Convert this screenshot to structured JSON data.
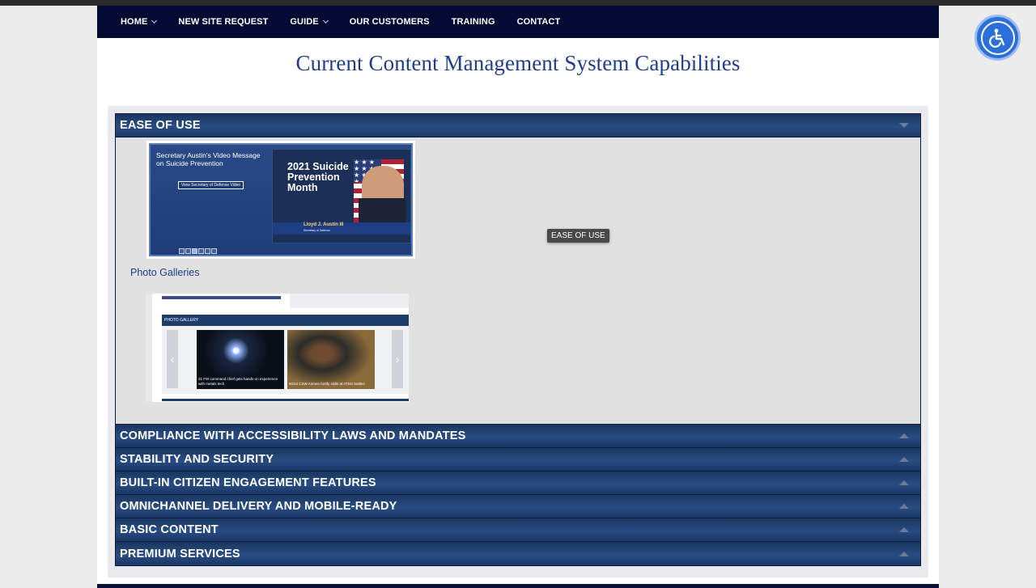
{
  "nav": {
    "items": [
      {
        "label": "HOME",
        "has_caret": true
      },
      {
        "label": "NEW SITE REQUEST",
        "has_caret": false
      },
      {
        "label": "GUIDE",
        "has_caret": true
      },
      {
        "label": "OUR CUSTOMERS",
        "has_caret": false
      },
      {
        "label": "TRAINING",
        "has_caret": false
      },
      {
        "label": "CONTACT",
        "has_caret": false
      }
    ]
  },
  "page_title": "Current Content Management System Capabilities",
  "accordion": {
    "open_section": {
      "label": "EASE OF USE",
      "tooltip": "EASE OF USE",
      "slideshow": {
        "message_title": "Secretary Austin's Video Message on Suicide Prevention",
        "video_button": "View Secretary of Defense Video",
        "poster_text": "2021 Suicide Prevention Month",
        "poster_name": "Lloyd J. Austin III",
        "poster_role": "Secretary of Defense",
        "slide_count": 6,
        "active_slide": 3
      },
      "gallery_link": "Photo Galleries",
      "gallery": {
        "header": "PHOTO GALLERY",
        "captions": [
          "31 FW command chief gets hands-on experience with metals tech",
          "501st CSW Airmen fortify skills at ATSO battles"
        ]
      }
    },
    "sections": [
      {
        "label": "COMPLIANCE WITH ACCESSIBILITY LAWS AND MANDATES"
      },
      {
        "label": "STABILITY AND SECURITY"
      },
      {
        "label": "BUILT-IN CITIZEN ENGAGEMENT FEATURES"
      },
      {
        "label": "OMNICHANNEL DELIVERY AND MOBILE-READY"
      },
      {
        "label": "BASIC CONTENT"
      },
      {
        "label": "PREMIUM SERVICES"
      }
    ]
  },
  "accessibility_button": {
    "icon": "wheelchair-icon"
  },
  "colors": {
    "nav_bg": "#050a35",
    "title": "#1f3d8f",
    "accordion_header": "#294d83",
    "accessibility": "#2b6fdd"
  }
}
